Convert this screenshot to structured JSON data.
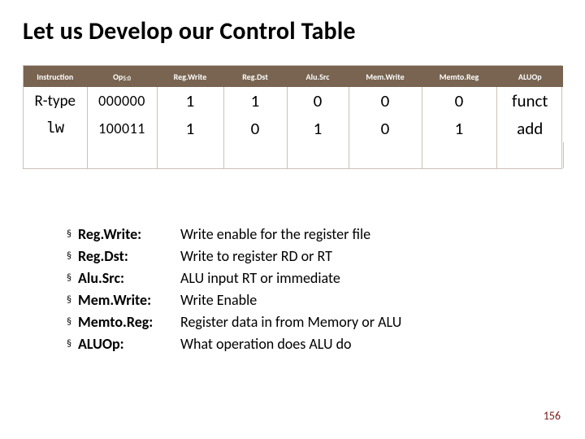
{
  "title": "Let us Develop our Control Table",
  "table": {
    "headers": {
      "instruction": "Instruction",
      "op_prefix": "Op",
      "op_sub": "5:0",
      "regwrite": "Reg.Write",
      "regdst": "Reg.Dst",
      "alusrc": "Alu.Src",
      "memwrite": "Mem.Write",
      "memtoreg": "Memto.Reg",
      "aluop": "ALUOp"
    },
    "rows": [
      {
        "instr": "R-type",
        "op": "000000",
        "regwrite": "1",
        "regdst": "1",
        "alusrc": "0",
        "memwrite": "0",
        "memtoreg": "0",
        "aluop": "funct"
      },
      {
        "instr": "lw",
        "op": "100011",
        "regwrite": "1",
        "regdst": "0",
        "alusrc": "1",
        "memwrite": "0",
        "memtoreg": "1",
        "aluop": "add"
      }
    ]
  },
  "definitions": [
    {
      "term": "Reg.Write:",
      "desc": "Write enable for the register file"
    },
    {
      "term": "Reg.Dst:",
      "desc": "Write to register RD or RT"
    },
    {
      "term": "Alu.Src:",
      "desc": "ALU input RT or immediate"
    },
    {
      "term": "Mem.Write:",
      "desc": "Write Enable"
    },
    {
      "term": "Memto.Reg:",
      "desc": "Register data in from Memory or ALU"
    },
    {
      "term": "ALUOp:",
      "desc": "What operation does ALU do"
    }
  ],
  "page_number": "156",
  "bullet_char": "§"
}
